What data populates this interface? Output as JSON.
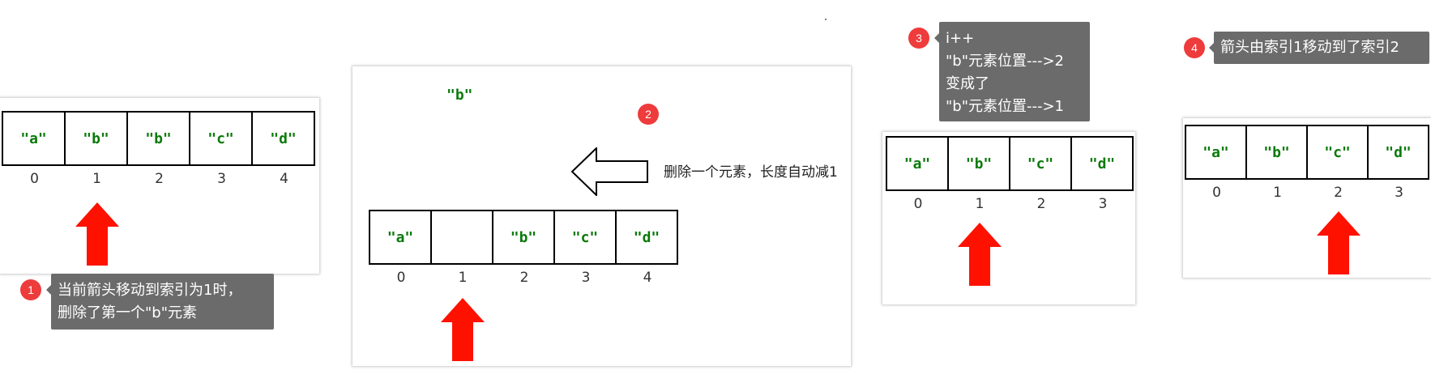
{
  "steps": [
    {
      "cells": [
        "\"a\"",
        "\"b\"",
        "\"b\"",
        "\"c\"",
        "\"d\""
      ],
      "indices": [
        "0",
        "1",
        "2",
        "3",
        "4"
      ],
      "pointer_index": 1,
      "badge": "1",
      "callout": [
        "当前箭头移动到索引为1时，",
        "删除了第一个\"b\"元素"
      ]
    },
    {
      "removed": "\"b\"",
      "badge": "2",
      "note": "删除一个元素，长度自动减1",
      "cells": [
        "\"a\"",
        "",
        "\"b\"",
        "\"c\"",
        "\"d\""
      ],
      "indices": [
        "0",
        "1",
        "2",
        "3",
        "4"
      ],
      "pointer_index": 1
    },
    {
      "cells": [
        "\"a\"",
        "\"b\"",
        "\"c\"",
        "\"d\""
      ],
      "indices": [
        "0",
        "1",
        "2",
        "3"
      ],
      "pointer_index": 1,
      "badge": "3",
      "callout": [
        "i++",
        "\"b\"元素位置--->2",
        "变成了",
        "\"b\"元素位置--->1"
      ]
    },
    {
      "cells": [
        "\"a\"",
        "\"b\"",
        "\"c\"",
        "\"d\""
      ],
      "indices": [
        "0",
        "1",
        "2",
        "3"
      ],
      "pointer_index": 2,
      "badge": "4",
      "callout": [
        "箭头由索引1移动到了索引2"
      ]
    }
  ],
  "icons": {
    "pointer": "red-up-arrow-icon",
    "shift": "hollow-left-arrow-icon"
  },
  "colors": {
    "cell_text": "#0a7a0a",
    "arrow": "#ff1100",
    "badge": "#ee3b3b",
    "callout_bg": "#6b6b6b"
  }
}
